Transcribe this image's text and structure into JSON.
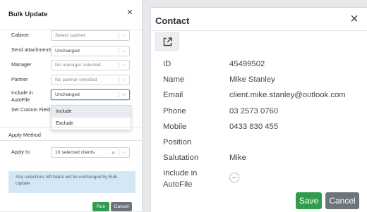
{
  "bulk_update": {
    "title": "Bulk Update",
    "close_glyph": "×",
    "fields": [
      {
        "label": "Cabinet",
        "value": "Select cabinet"
      },
      {
        "label": "Send attachments",
        "value": "Unchanged"
      },
      {
        "label": "Manager",
        "value": "No manager selected"
      },
      {
        "label": "Partner",
        "value": "No partner selected"
      },
      {
        "label_line1": "Include in",
        "label_line2": "AutoFile",
        "value": "Unchanged"
      }
    ],
    "set_custom_field_label": "Set Custom Field",
    "dropdown_options": [
      "Include",
      "Exclude"
    ],
    "apply_method_title": "Apply Method",
    "apply_to_label": "Apply to",
    "apply_to_value": "10 selected clients",
    "clear_glyph": "×",
    "info_text": "Any selections left blank will be unchanged by Bulk Update",
    "run_label": "Run",
    "cancel_label": "Cancel",
    "chevron_glyph": "⌵"
  },
  "contact": {
    "title": "Contact",
    "close_glyph": "×",
    "fields": [
      {
        "label": "ID",
        "value": "45499502"
      },
      {
        "label": "Name",
        "value": "Mike Stanley"
      },
      {
        "label": "Email",
        "value": "client.mike.stanley@outlook.com"
      },
      {
        "label": "Phone",
        "value": "03 2573 0760"
      },
      {
        "label": "Mobile",
        "value": "0433 830 455"
      },
      {
        "label": "Position",
        "value": ""
      },
      {
        "label": "Salutation",
        "value": "Mike"
      }
    ],
    "include_label_line1": "Include in",
    "include_label_line2": "AutoFile",
    "save_label": "Save",
    "cancel_label": "Cancel"
  },
  "colors": {
    "save_green": "#2e9e4e",
    "cancel_gray": "#6c757d",
    "info_bg": "#d4e7f5",
    "focus_blue": "#6d8fd0"
  },
  "icons": {
    "external_link": "external-link-icon",
    "close": "close-icon",
    "chevron": "chevron-down-icon",
    "toggle": "toggle-indeterminate-icon"
  }
}
